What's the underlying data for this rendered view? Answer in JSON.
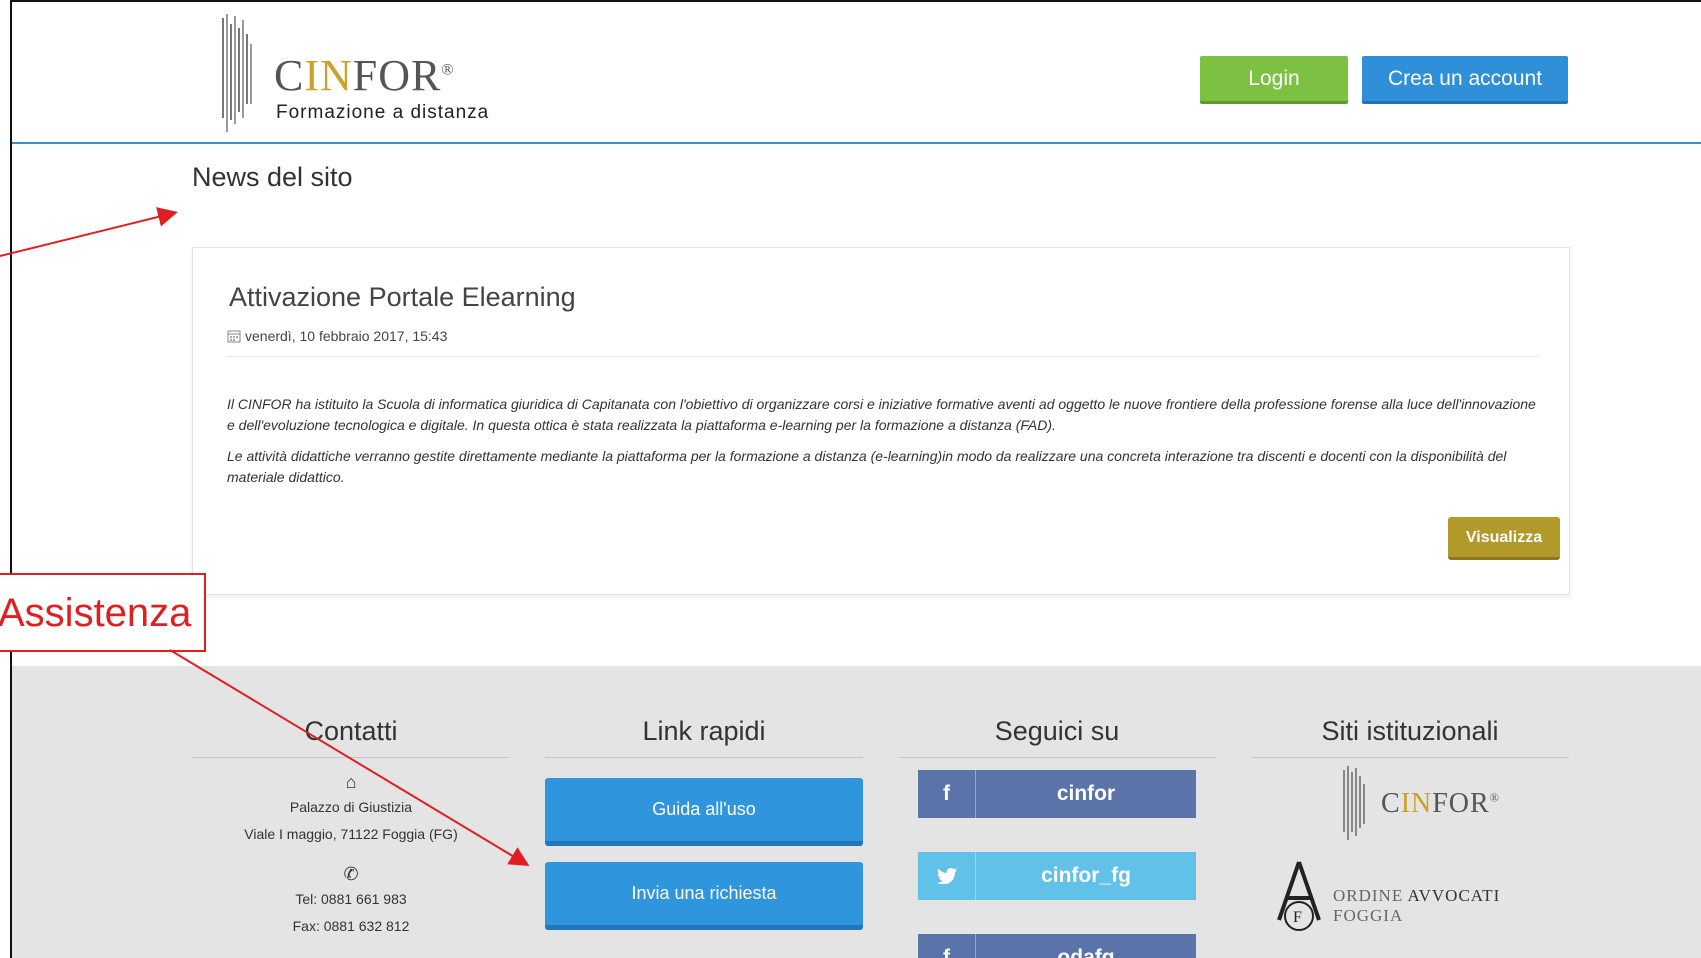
{
  "header": {
    "logo_name_pre": "C",
    "logo_name_accent": "IN",
    "logo_name_post": "FOR",
    "logo_reg": "®",
    "logo_subtitle": "Formazione a distanza",
    "login_label": "Login",
    "create_account_label": "Crea un account",
    "accent_color": "#3b8fc8"
  },
  "main": {
    "page_title": "News del sito",
    "news": {
      "title": "Attivazione Portale Elearning",
      "date": "venerdì, 10 febbraio 2017, 15:43",
      "paragraphs": [
        "Il CINFOR ha istituito la Scuola di informatica giuridica di Capitanata con l'obiettivo di organizzare corsi e iniziative formative aventi ad oggetto le nuove frontiere della professione forense alla luce dell'innovazione e dell'evoluzione tecnologica e digitale. In questa ottica è stata realizzata la piattaforma e-learning per la formazione a distanza (FAD).",
        "Le attività didattiche verranno gestite direttamente mediante la piattaforma per la formazione a distanza (e-learning)in modo da realizzare una concreta interazione tra discenti e docenti con la disponibilità del materiale didattico."
      ],
      "view_label": "Visualizza"
    }
  },
  "footer": {
    "contacts": {
      "title": "Contatti",
      "address_line1": "Palazzo di Giustizia",
      "address_line2": "Viale I maggio, 71122 Foggia (FG)",
      "tel": "Tel: 0881 661 983",
      "fax": "Fax: 0881 632 812"
    },
    "quick_links": {
      "title": "Link rapidi",
      "items": [
        "Guida all'uso",
        "Invia una richiesta"
      ]
    },
    "social": {
      "title": "Seguici su",
      "items": [
        {
          "icon": "facebook-icon",
          "glyph": "f",
          "label": "cinfor"
        },
        {
          "icon": "twitter-icon",
          "glyph": "t",
          "label": "cinfor_fg"
        },
        {
          "icon": "facebook-icon",
          "glyph": "f",
          "label": "odafg"
        }
      ]
    },
    "institutional": {
      "title": "Siti istituzionali",
      "cinfor_pre": "C",
      "cinfor_accent": "IN",
      "cinfor_post": "FOR",
      "cinfor_reg": "®",
      "ordine_pre": "ORDINE ",
      "ordine_bold": "AVVOCATI",
      "ordine_post": " FOGGIA",
      "seal_letters": "AF"
    }
  },
  "annotation": {
    "label": "Assistenza",
    "color": "#e02020"
  }
}
